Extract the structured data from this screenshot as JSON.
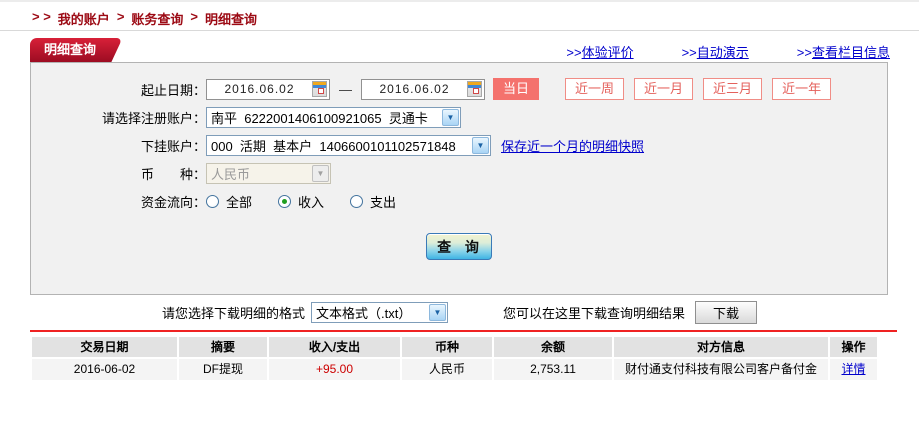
{
  "breadcrumb": {
    "prefix": "> >",
    "sep": ">",
    "items": [
      "我的账户",
      "账务查询",
      "明细查询"
    ]
  },
  "header": {
    "tab": "明细查询",
    "links": [
      {
        "prefix": ">>",
        "label": "体验评价"
      },
      {
        "prefix": ">>",
        "label": "自动演示"
      },
      {
        "prefix": ">>",
        "label": "查看栏目信息"
      }
    ]
  },
  "form": {
    "date_label": "起止日期：",
    "date_from": "2016.06.02",
    "date_sep": "—",
    "date_to": "2016.06.02",
    "quick": [
      "当日",
      "近一周",
      "近一月",
      "近三月",
      "近一年"
    ],
    "register_label": "请选择注册账户：",
    "register_value": "南平  6222001406100921065  灵通卡",
    "sub_label": "下挂账户：",
    "sub_value": "000  活期  基本户  1406600101102571848",
    "snapshot_link": "保存近一个月的明细快照",
    "currency_label": "币　　种：",
    "currency_value": "人民币",
    "flow_label": "资金流向：",
    "flow_options": [
      {
        "label": "全部",
        "checked": false
      },
      {
        "label": "收入",
        "checked": true
      },
      {
        "label": "支出",
        "checked": false
      }
    ],
    "query_button": "查  询",
    "dropdown_arrow": "▼"
  },
  "download": {
    "format_label": "请您选择下载明细的格式",
    "format_value": "文本格式（.txt）",
    "hint": "您可以在这里下载查询明细结果",
    "button": "下载"
  },
  "table": {
    "columns": [
      "交易日期",
      "摘要",
      "收入/支出",
      "币种",
      "余额",
      "对方信息",
      "操作"
    ],
    "rows": [
      {
        "date": "2016-06-02",
        "summary": "DF提现",
        "amount": "+95.00",
        "currency": "人民币",
        "balance": "2,753.11",
        "counterparty": "财付通支付科技有限公司客户备付金",
        "action": "详情"
      }
    ]
  },
  "colors": {
    "brand_red": "#a50f23",
    "breadcrumb_red": "#9c0a14",
    "link_blue": "#0000cc",
    "amount_red": "#cc0000",
    "active_quick_button": "#f4726d",
    "table_header_bg": "#e2e2e2",
    "table_row_bg": "#f4f4f4",
    "divider_red": "#ef2222"
  }
}
